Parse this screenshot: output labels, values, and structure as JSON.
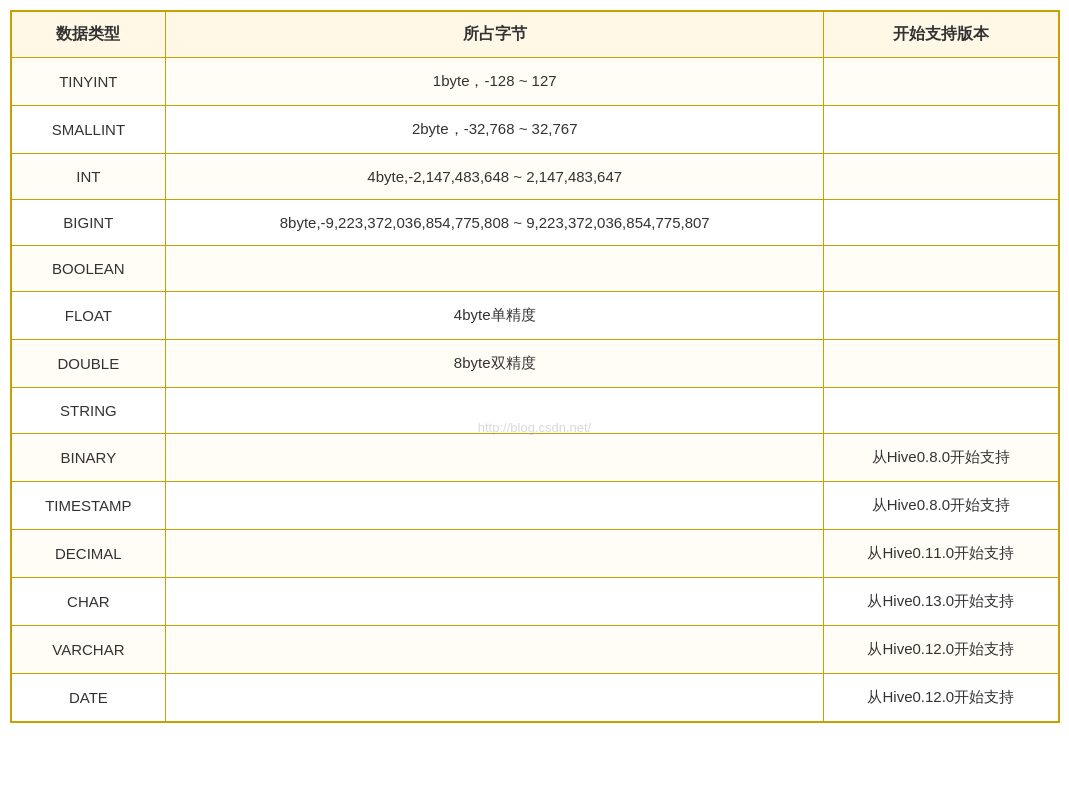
{
  "table": {
    "headers": [
      "数据类型",
      "所占字节",
      "开始支持版本"
    ],
    "rows": [
      {
        "type": "TINYINT",
        "bytes": "1byte，-128 ~ 127",
        "version": ""
      },
      {
        "type": "SMALLINT",
        "bytes": "2byte，-32,768 ~ 32,767",
        "version": ""
      },
      {
        "type": "INT",
        "bytes": "4byte,-2,147,483,648 ~ 2,147,483,647",
        "version": ""
      },
      {
        "type": "BIGINT",
        "bytes": "8byte,-9,223,372,036,854,775,808 ~ 9,223,372,036,854,775,807",
        "version": ""
      },
      {
        "type": "BOOLEAN",
        "bytes": "",
        "version": ""
      },
      {
        "type": "FLOAT",
        "bytes": "4byte单精度",
        "version": ""
      },
      {
        "type": "DOUBLE",
        "bytes": "8byte双精度",
        "version": ""
      },
      {
        "type": "STRING",
        "bytes": "",
        "version": ""
      },
      {
        "type": "BINARY",
        "bytes": "",
        "version": "从Hive0.8.0开始支持"
      },
      {
        "type": "TIMESTAMP",
        "bytes": "",
        "version": "从Hive0.8.0开始支持"
      },
      {
        "type": "DECIMAL",
        "bytes": "",
        "version": "从Hive0.11.0开始支持"
      },
      {
        "type": "CHAR",
        "bytes": "",
        "version": "从Hive0.13.0开始支持"
      },
      {
        "type": "VARCHAR",
        "bytes": "",
        "version": "从Hive0.12.0开始支持"
      },
      {
        "type": "DATE",
        "bytes": "",
        "version": "从Hive0.12.0开始支持"
      }
    ]
  },
  "watermark": "http://blog.csdn.net/"
}
